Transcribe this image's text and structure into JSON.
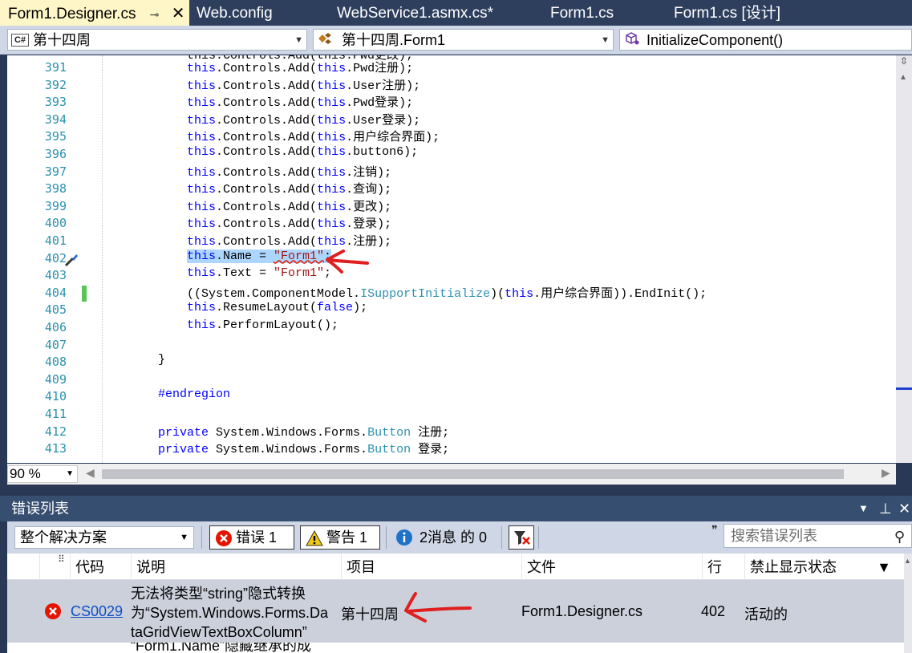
{
  "tabs": [
    {
      "label": "Form1.Designer.cs",
      "active": true
    },
    {
      "label": "Web.config",
      "active": false
    },
    {
      "label": "WebService1.asmx.cs*",
      "active": false
    },
    {
      "label": "Form1.cs",
      "active": false
    },
    {
      "label": "Form1.cs [设计]",
      "active": false
    }
  ],
  "tab_pin_glyph": "⊸",
  "tab_close_glyph": "✕",
  "nav": {
    "project": "第十四周",
    "class": "第十四周.Form1",
    "member": "InitializeComponent()",
    "cs_badge": "C#"
  },
  "code": {
    "line_numbers": [
      "391",
      "392",
      "393",
      "394",
      "395",
      "396",
      "397",
      "398",
      "399",
      "400",
      "401",
      "402",
      "403",
      "404",
      "405",
      "406",
      "407",
      "408",
      "409",
      "410",
      "411",
      "412",
      "413"
    ],
    "lines": [
      [
        [
          "kw",
          "this"
        ],
        [
          "",
          "."
        ],
        [
          "",
          "Controls.Add("
        ],
        [
          "kw",
          "this"
        ],
        [
          "",
          ".Pwd注册);"
        ]
      ],
      [
        [
          "kw",
          "this"
        ],
        [
          "",
          "."
        ],
        [
          "",
          "Controls.Add("
        ],
        [
          "kw",
          "this"
        ],
        [
          "",
          ".User注册);"
        ]
      ],
      [
        [
          "kw",
          "this"
        ],
        [
          "",
          "."
        ],
        [
          "",
          "Controls.Add("
        ],
        [
          "kw",
          "this"
        ],
        [
          "",
          ".Pwd登录);"
        ]
      ],
      [
        [
          "kw",
          "this"
        ],
        [
          "",
          "."
        ],
        [
          "",
          "Controls.Add("
        ],
        [
          "kw",
          "this"
        ],
        [
          "",
          ".User登录);"
        ]
      ],
      [
        [
          "kw",
          "this"
        ],
        [
          "",
          "."
        ],
        [
          "",
          "Controls.Add("
        ],
        [
          "kw",
          "this"
        ],
        [
          "",
          ".用户综合界面);"
        ]
      ],
      [
        [
          "kw",
          "this"
        ],
        [
          "",
          "."
        ],
        [
          "",
          "Controls.Add("
        ],
        [
          "kw",
          "this"
        ],
        [
          "",
          ".button6);"
        ]
      ],
      [
        [
          "kw",
          "this"
        ],
        [
          "",
          "."
        ],
        [
          "",
          "Controls.Add("
        ],
        [
          "kw",
          "this"
        ],
        [
          "",
          ".注销);"
        ]
      ],
      [
        [
          "kw",
          "this"
        ],
        [
          "",
          "."
        ],
        [
          "",
          "Controls.Add("
        ],
        [
          "kw",
          "this"
        ],
        [
          "",
          ".查询);"
        ]
      ],
      [
        [
          "kw",
          "this"
        ],
        [
          "",
          "."
        ],
        [
          "",
          "Controls.Add("
        ],
        [
          "kw",
          "this"
        ],
        [
          "",
          ".更改);"
        ]
      ],
      [
        [
          "kw",
          "this"
        ],
        [
          "",
          "."
        ],
        [
          "",
          "Controls.Add("
        ],
        [
          "kw",
          "this"
        ],
        [
          "",
          ".登录);"
        ]
      ],
      [
        [
          "kw",
          "this"
        ],
        [
          "",
          "."
        ],
        [
          "",
          "Controls.Add("
        ],
        [
          "kw",
          "this"
        ],
        [
          "",
          ".注册);"
        ]
      ],
      [
        [
          "kw sel",
          "this"
        ],
        [
          "sel",
          ".Name = "
        ],
        [
          "str sel squig",
          "\"Form1\""
        ],
        [
          "sel",
          ";"
        ]
      ],
      [
        [
          "kw",
          "this"
        ],
        [
          "",
          ".Text = "
        ],
        [
          "str",
          "\"Form1\""
        ],
        [
          "",
          ";"
        ]
      ],
      [
        [
          "",
          "(("
        ],
        [
          "",
          "System.ComponentModel."
        ],
        [
          "typ",
          "ISupportInitialize"
        ],
        [
          "",
          ")("
        ],
        [
          "kw",
          "this"
        ],
        [
          "",
          ".用户综合界面)).EndInit();"
        ]
      ],
      [
        [
          "kw",
          "this"
        ],
        [
          "",
          ".ResumeLayout("
        ],
        [
          "kw",
          "false"
        ],
        [
          "",
          ");"
        ]
      ],
      [
        [
          "kw",
          "this"
        ],
        [
          "",
          ".PerformLayout();"
        ]
      ],
      [
        [
          "",
          ""
        ]
      ],
      [
        [
          "",
          "}"
        ]
      ],
      [
        [
          "",
          ""
        ]
      ],
      [
        [
          "kw",
          "#endregion"
        ]
      ],
      [
        [
          "",
          ""
        ]
      ],
      [
        [
          "kw",
          "private"
        ],
        [
          "",
          ""
        ],
        [
          "",
          ""
        ],
        [
          "",
          ""
        ],
        [
          "",
          ""
        ],
        [
          "",
          ""
        ]
      ],
      [
        [
          "kw",
          "private"
        ],
        [
          "",
          ""
        ],
        [
          "",
          ""
        ],
        [
          "",
          ""
        ],
        [
          "",
          ""
        ],
        [
          "",
          ""
        ]
      ]
    ],
    "line412_rest": " System.Windows.Forms.",
    "line412_type": "Button",
    "line412_name": " 注册;",
    "line413_rest": " System.Windows.Forms.",
    "line413_type": "Button",
    "line413_name": " 登录;",
    "partial_top": "this.Controls.Add(this.Pwd更改);"
  },
  "zoom": "90 %",
  "error_list": {
    "title": "错误列表",
    "scope": "整个解决方案",
    "errors_label": "错误 1",
    "warnings_label": "警告 1",
    "messages_label": "2消息 的 0",
    "search_placeholder": "搜索错误列表",
    "columns": [
      "代码",
      "说明",
      "项目",
      "文件",
      "行",
      "禁止显示状态"
    ],
    "rows": [
      {
        "code": "CS0029",
        "description_lines": [
          "无法将类型“string”隐式转换",
          "为“System.Windows.Forms.Da",
          "taGridViewTextBoxColumn”"
        ],
        "project": "第十四周",
        "file": "Form1.Designer.cs",
        "line": "402",
        "suppression": "活动的"
      }
    ],
    "partial_next_row": "“Form1.Name”隐藏继承的成"
  },
  "colors": {
    "tab_active_bg": "#fff6c7",
    "chrome_bg": "#293955",
    "keyword": "#0000ff",
    "string": "#a31515",
    "type": "#2b91af",
    "selection": "#add6ff",
    "annotation_red": "#e02020"
  }
}
